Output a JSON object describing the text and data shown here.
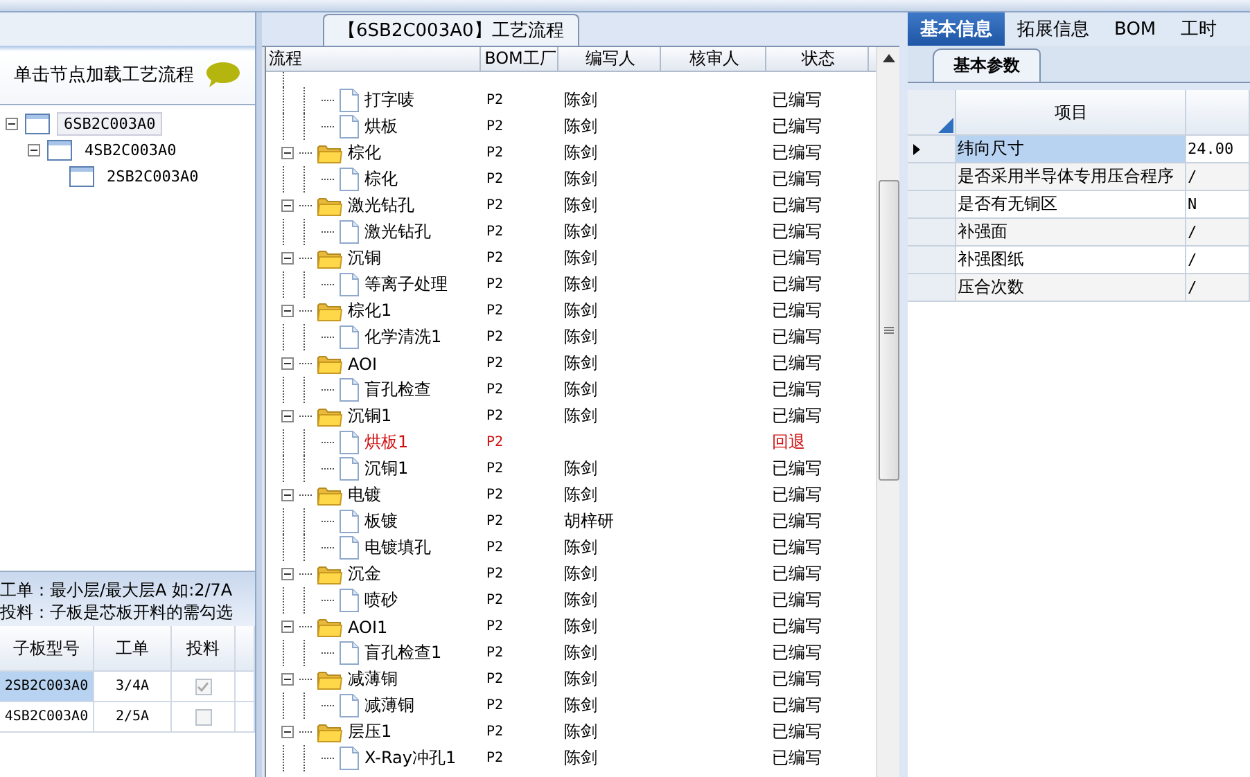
{
  "left_panel": {
    "hint": "单击节点加载工艺流程",
    "tree": [
      {
        "label": "6SB2C003A0",
        "expanded": true,
        "selected": true,
        "children": [
          {
            "label": "4SB2C003A0",
            "expanded": true,
            "selected": false,
            "children": [
              {
                "label": "2SB2C003A0",
                "selected": false
              }
            ]
          }
        ]
      }
    ],
    "notes": [
      "工单：最小层/最大层A 如:2/7A",
      "投料：子板是芯板开料的需勾选"
    ],
    "grid": {
      "columns": [
        "子板型号",
        "工单",
        "投料"
      ],
      "rows": [
        {
          "model": "2SB2C003A0",
          "order": "3/4A",
          "checked": true,
          "disabled": true,
          "selected": true
        },
        {
          "model": "4SB2C003A0",
          "order": "2/5A",
          "checked": false,
          "disabled": true,
          "selected": false
        }
      ]
    }
  },
  "process_panel": {
    "title": "【6SB2C003A0】工艺流程",
    "columns": [
      "流程",
      "BOM工厂",
      "编写人",
      "核审人",
      "状态"
    ],
    "groups": [
      {
        "children": [
          {
            "name": "打字唛",
            "factory": "P2",
            "writer": "陈剑",
            "status": "已编写",
            "returned": false
          },
          {
            "name": "烘板",
            "factory": "P2",
            "writer": "陈剑",
            "status": "已编写",
            "returned": false
          }
        ]
      },
      {
        "name": "棕化",
        "factory": "P2",
        "writer": "陈剑",
        "status": "已编写",
        "returned": false,
        "expanded": true,
        "children": [
          {
            "name": "棕化",
            "factory": "P2",
            "writer": "陈剑",
            "status": "已编写",
            "returned": false
          }
        ]
      },
      {
        "name": "激光钻孔",
        "factory": "P2",
        "writer": "陈剑",
        "status": "已编写",
        "returned": false,
        "expanded": true,
        "children": [
          {
            "name": "激光钻孔",
            "factory": "P2",
            "writer": "陈剑",
            "status": "已编写",
            "returned": false
          }
        ]
      },
      {
        "name": "沉铜",
        "factory": "P2",
        "writer": "陈剑",
        "status": "已编写",
        "returned": false,
        "expanded": true,
        "children": [
          {
            "name": "等离子处理",
            "factory": "P2",
            "writer": "陈剑",
            "status": "已编写",
            "returned": false
          }
        ]
      },
      {
        "name": "棕化1",
        "factory": "P2",
        "writer": "陈剑",
        "status": "已编写",
        "returned": false,
        "expanded": true,
        "children": [
          {
            "name": "化学清洗1",
            "factory": "P2",
            "writer": "陈剑",
            "status": "已编写",
            "returned": false
          }
        ]
      },
      {
        "name": "AOI",
        "factory": "P2",
        "writer": "陈剑",
        "status": "已编写",
        "returned": false,
        "expanded": true,
        "children": [
          {
            "name": "盲孔检查",
            "factory": "P2",
            "writer": "陈剑",
            "status": "已编写",
            "returned": false
          }
        ]
      },
      {
        "name": "沉铜1",
        "factory": "P2",
        "writer": "陈剑",
        "status": "已编写",
        "returned": false,
        "expanded": true,
        "children": [
          {
            "name": "烘板1",
            "factory": "P2",
            "status": "回退",
            "returned": true
          },
          {
            "name": "沉铜1",
            "factory": "P2",
            "writer": "陈剑",
            "status": "已编写",
            "returned": false
          }
        ]
      },
      {
        "name": "电镀",
        "factory": "P2",
        "writer": "陈剑",
        "status": "已编写",
        "returned": false,
        "expanded": true,
        "children": [
          {
            "name": "板镀",
            "factory": "P2",
            "writer": "胡梓研",
            "status": "已编写",
            "returned": false
          },
          {
            "name": "电镀填孔",
            "factory": "P2",
            "writer": "陈剑",
            "status": "已编写",
            "returned": false
          }
        ]
      },
      {
        "name": "沉金",
        "factory": "P2",
        "writer": "陈剑",
        "status": "已编写",
        "returned": false,
        "expanded": true,
        "children": [
          {
            "name": "喷砂",
            "factory": "P2",
            "writer": "陈剑",
            "status": "已编写",
            "returned": false
          }
        ]
      },
      {
        "name": "AOI1",
        "factory": "P2",
        "writer": "陈剑",
        "status": "已编写",
        "returned": false,
        "expanded": true,
        "children": [
          {
            "name": "盲孔检查1",
            "factory": "P2",
            "writer": "陈剑",
            "status": "已编写",
            "returned": false
          }
        ]
      },
      {
        "name": "减薄铜",
        "factory": "P2",
        "writer": "陈剑",
        "status": "已编写",
        "returned": false,
        "expanded": true,
        "children": [
          {
            "name": "减薄铜",
            "factory": "P2",
            "writer": "陈剑",
            "status": "已编写",
            "returned": false
          }
        ]
      },
      {
        "name": "层压1",
        "factory": "P2",
        "writer": "陈剑",
        "status": "已编写",
        "returned": false,
        "expanded": true,
        "children": [
          {
            "name": "X-Ray冲孔1",
            "factory": "P2",
            "writer": "陈剑",
            "status": "已编写",
            "returned": false
          }
        ]
      }
    ]
  },
  "info_panel": {
    "tabs": [
      {
        "label": "基本信息",
        "selected": true
      },
      {
        "label": "拓展信息",
        "selected": false
      },
      {
        "label": "BOM",
        "selected": false
      },
      {
        "label": "工时",
        "selected": false
      }
    ],
    "subtab": "基本参数",
    "column": "项目",
    "rows": [
      {
        "item": "纬向尺寸",
        "value": "24.00",
        "selected": true
      },
      {
        "item": "是否采用半导体专用压合程序",
        "value": "/",
        "selected": false
      },
      {
        "item": "是否有无铜区",
        "value": "N",
        "selected": false
      },
      {
        "item": "补强面",
        "value": "/",
        "selected": false
      },
      {
        "item": "补强图纸",
        "value": "/",
        "selected": false
      },
      {
        "item": "压合次数",
        "value": "/",
        "selected": false
      }
    ]
  }
}
